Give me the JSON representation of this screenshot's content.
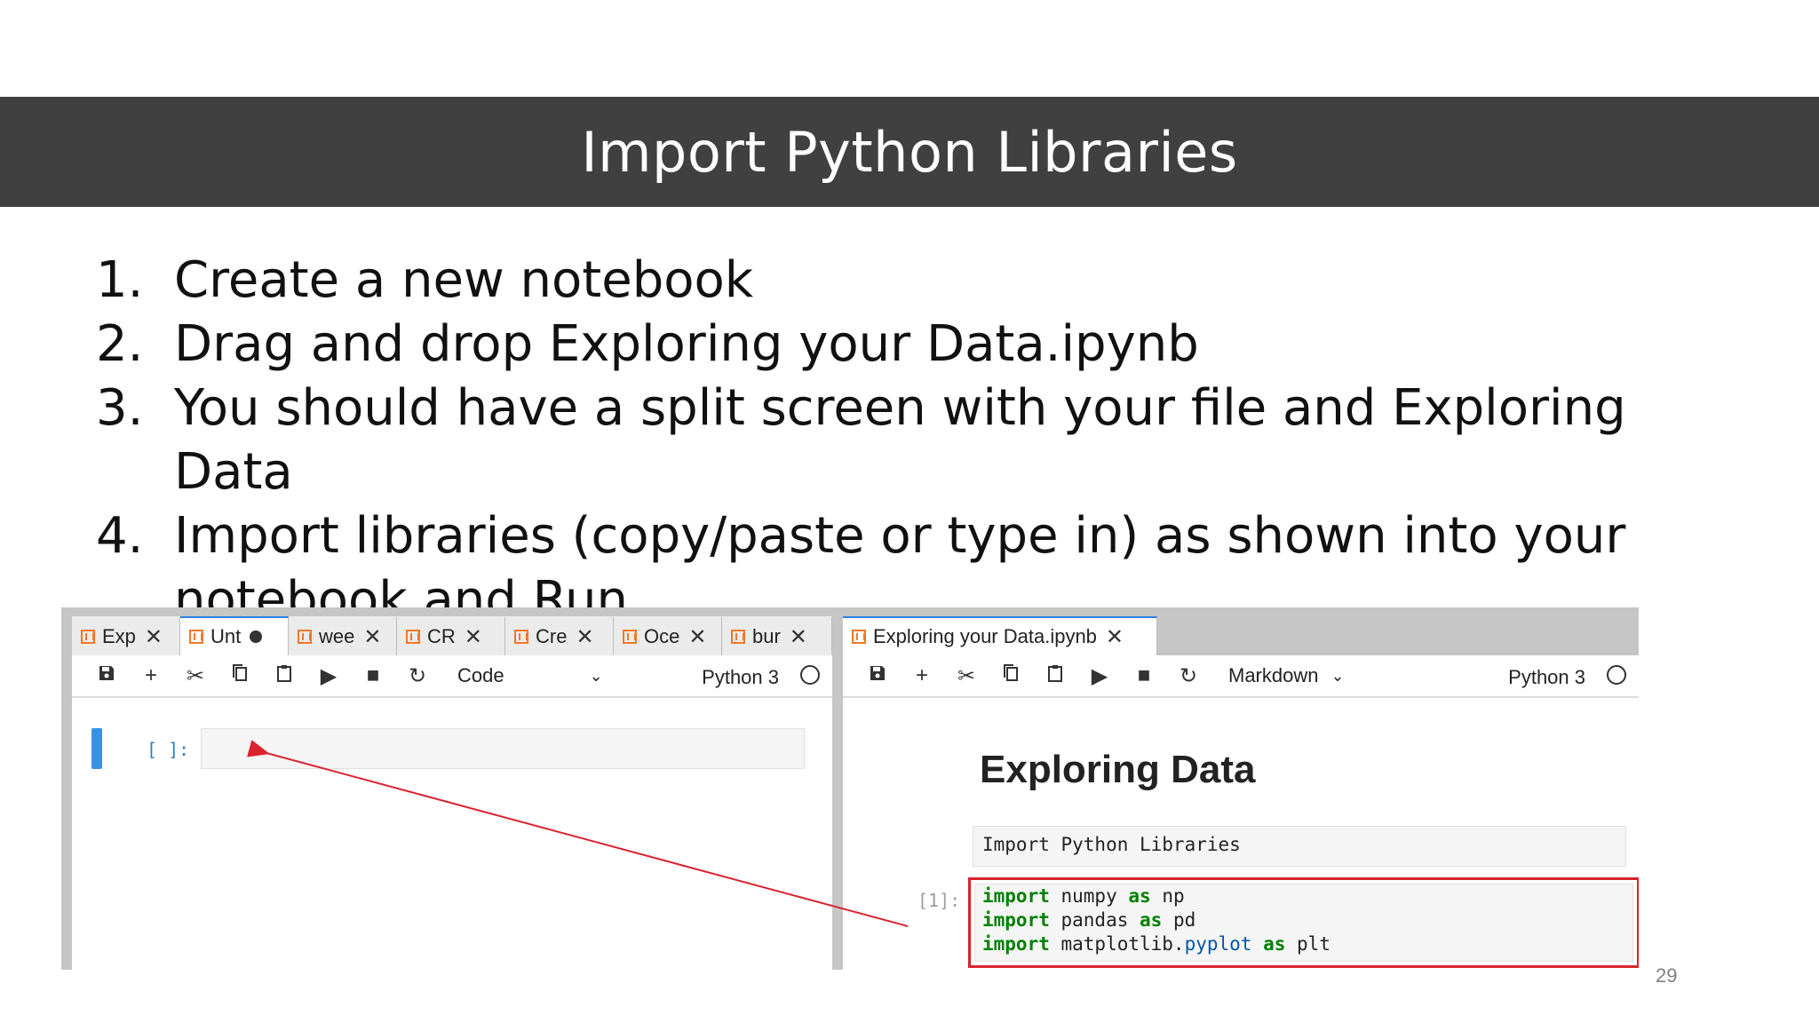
{
  "slide": {
    "title": "Import Python Libraries",
    "steps": [
      {
        "num": "1.",
        "text": "Create a new notebook"
      },
      {
        "num": "2.",
        "text": "Drag and drop Exploring your Data.ipynb"
      },
      {
        "num": "3.",
        "text": "You should have a split screen with your file and Exploring Data"
      },
      {
        "num": "4.",
        "text": "Import libraries (copy/paste or type in) as shown into your notebook and Run"
      }
    ],
    "page_number": "29"
  },
  "left_pane": {
    "tabs": [
      {
        "label": "Exp",
        "state": "close"
      },
      {
        "label": "Unt",
        "state": "modified"
      },
      {
        "label": "wee",
        "state": "close"
      },
      {
        "label": "CR",
        "state": "close"
      },
      {
        "label": "Cre",
        "state": "close"
      },
      {
        "label": "Oce",
        "state": "close"
      },
      {
        "label": "bur",
        "state": "close"
      }
    ],
    "cell_type": "Code",
    "kernel": "Python 3",
    "cell_prompt": "[ ]:"
  },
  "right_pane": {
    "tab": {
      "label": "Exploring your Data.ipynb"
    },
    "cell_type": "Markdown",
    "kernel": "Python 3",
    "heading": "Exploring Data",
    "markdown_text": "Import Python Libraries",
    "code_prompt": "[1]:",
    "code": {
      "line1": {
        "kw1": "import",
        "mod": " numpy ",
        "kw2": "as",
        "alias": " np"
      },
      "line2": {
        "kw1": "import",
        "mod": " pandas ",
        "kw2": "as",
        "alias": " pd"
      },
      "line3": {
        "kw1": "import",
        "mod": " matplotlib.",
        "attr": "pyplot",
        "sp": " ",
        "kw2": "as",
        "alias": " plt"
      }
    }
  },
  "icons": [
    "notebook-icon",
    "close-icon",
    "modified-dot-icon",
    "save-icon",
    "add-icon",
    "cut-icon",
    "copy-icon",
    "paste-icon",
    "run-icon",
    "stop-icon",
    "restart-icon",
    "chevron-down-icon",
    "kernel-idle-icon"
  ],
  "colors": {
    "title_bar": "#404040",
    "tab_active_border": "#2a82e4",
    "cell_selected": "#3d8fe6",
    "highlight": "#d9232e",
    "keyword": "#008000",
    "notebook_icon": "#f37726"
  }
}
